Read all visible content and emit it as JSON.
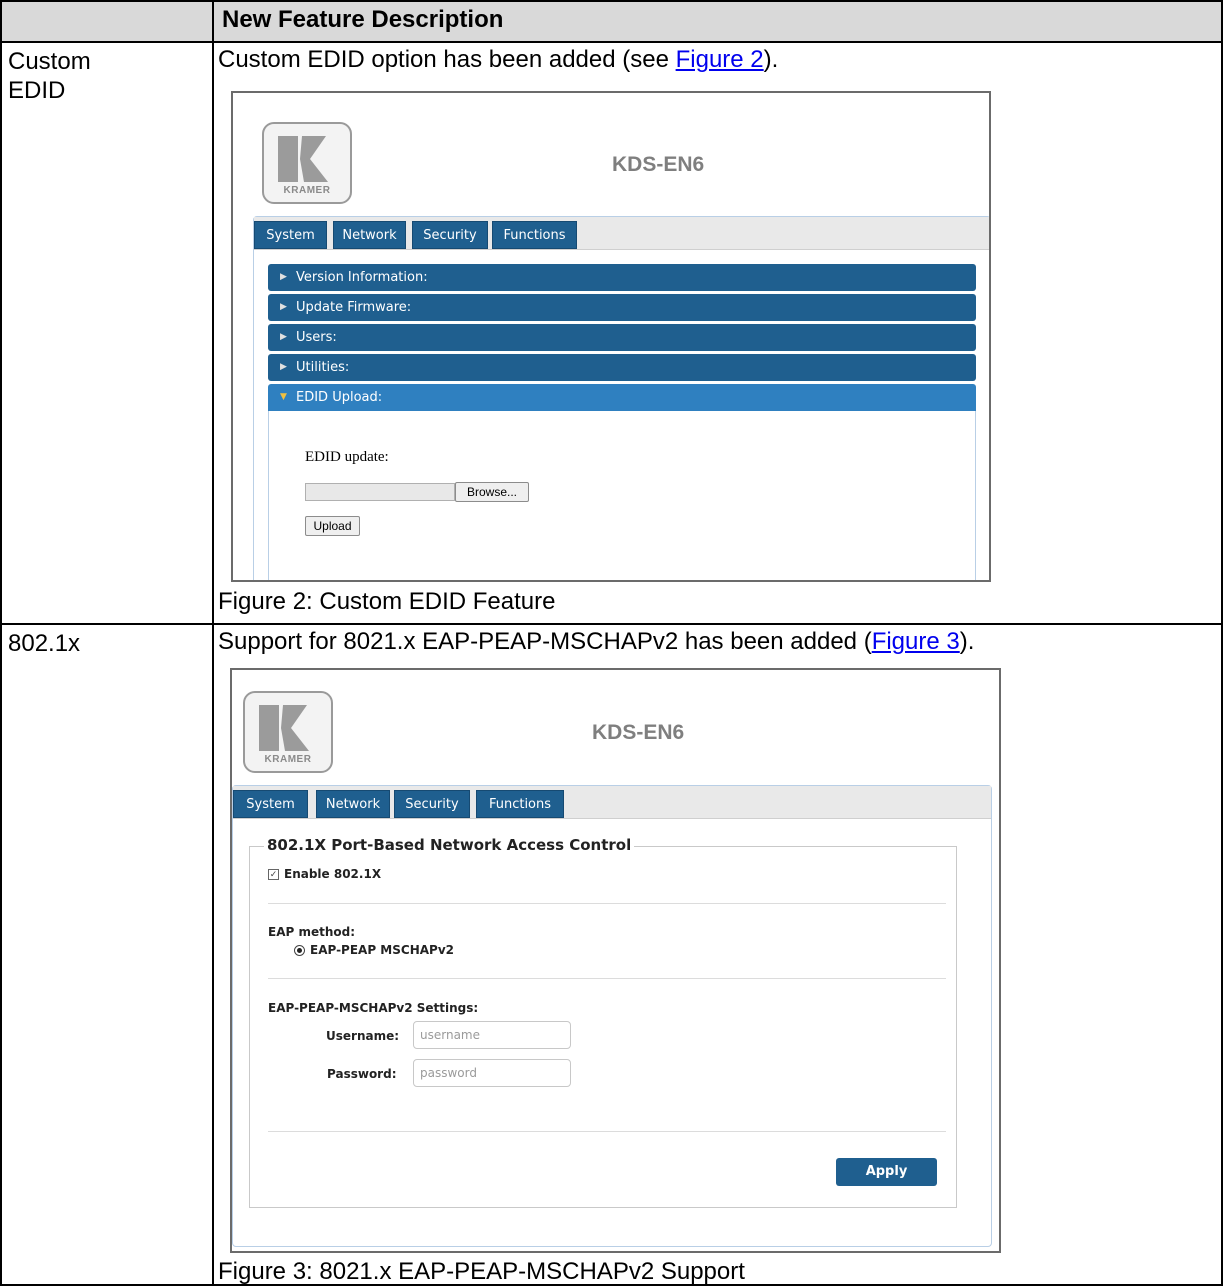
{
  "table": {
    "header_col2": "New Feature Description",
    "rows": [
      {
        "feature": "Custom\nEDID",
        "desc_before": "Custom EDID option has been added (see ",
        "desc_link": "Figure 2",
        "desc_after": ").",
        "caption": "Figure 2: Custom EDID Feature"
      },
      {
        "feature": "802.1x",
        "desc_before": "Support for 8021.x EAP-PEAP-MSCHAPv2 has been added (",
        "desc_link": "Figure 3",
        "desc_after": ").",
        "caption": "Figure 3: 8021.x EAP-PEAP-MSCHAPv2 Support"
      }
    ]
  },
  "web_ui": {
    "logo_text": "KRAMER",
    "device_title": "KDS-EN6",
    "tabs": [
      "System",
      "Network",
      "Security",
      "Functions"
    ]
  },
  "figure2": {
    "accordion": [
      "Version Information:",
      "Update Firmware:",
      "Users:",
      "Utilities:",
      "EDID Upload:"
    ],
    "edid_update_label": "EDID update:",
    "browse_label": "Browse...",
    "upload_label": "Upload"
  },
  "figure3": {
    "legend": "802.1X Port-Based Network Access Control",
    "enable_label": "Enable 802.1X",
    "eap_method_label": "EAP method:",
    "eap_option": "EAP-PEAP MSCHAPv2",
    "settings_label": "EAP-PEAP-MSCHAPv2 Settings:",
    "username_label": "Username:",
    "username_placeholder": "username",
    "password_label": "Password:",
    "password_placeholder": "password",
    "apply_label": "Apply"
  }
}
